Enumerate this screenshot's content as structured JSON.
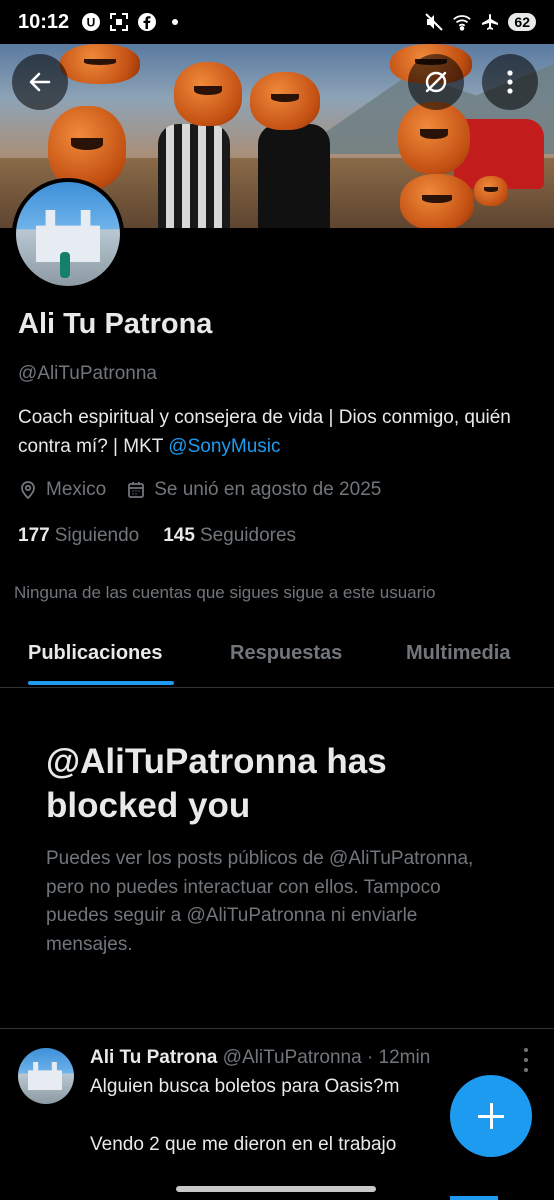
{
  "status_bar": {
    "time": "10:12",
    "battery": "62",
    "left_icons": [
      "u-badge-icon",
      "qr-scan-icon",
      "facebook-icon",
      "dot-icon"
    ],
    "right_icons": [
      "mute-icon",
      "wifi-icon",
      "airplane-icon"
    ]
  },
  "header": {
    "back_icon": "arrow-left-icon",
    "translate_icon": "no-sync-icon",
    "more_icon": "more-vertical-icon"
  },
  "profile": {
    "name": "Ali Tu Patrona",
    "handle": "@AliTuPatronna",
    "bio_text": "Coach espiritual y consejera de vida | Dios conmigo, quién contra mí? | MKT ",
    "bio_mention": "@SonyMusic",
    "location": "Mexico",
    "joined": "Se unió en agosto de 2025",
    "following_count": "177",
    "following_label": "Siguiendo",
    "followers_count": "145",
    "followers_label": "Seguidores",
    "mutual_note": "Ninguna de las cuentas que sigues sigue a este usuario"
  },
  "tabs": [
    {
      "label": "Publicaciones",
      "active": true
    },
    {
      "label": "Respuestas",
      "active": false
    },
    {
      "label": "Multimedia",
      "active": false
    }
  ],
  "blocked": {
    "title": "@AliTuPatronna has blocked you",
    "body": "Puedes ver los posts públicos de @AliTuPatronna, pero no puedes interactuar con ellos. Tampoco puedes seguir a @AliTuPatronna ni enviarle mensajes."
  },
  "post": {
    "name": "Ali Tu Patrona",
    "handle": "@AliTuPatronna",
    "separator": "·",
    "time": "12min",
    "line1": "Alguien busca boletos para Oasis?m",
    "line2": "Vendo 2 que me dieron en el trabajo"
  },
  "colors": {
    "accent": "#1d9bf0",
    "background": "#000000",
    "text_primary": "#e7e9ea",
    "text_secondary": "#71767b"
  }
}
